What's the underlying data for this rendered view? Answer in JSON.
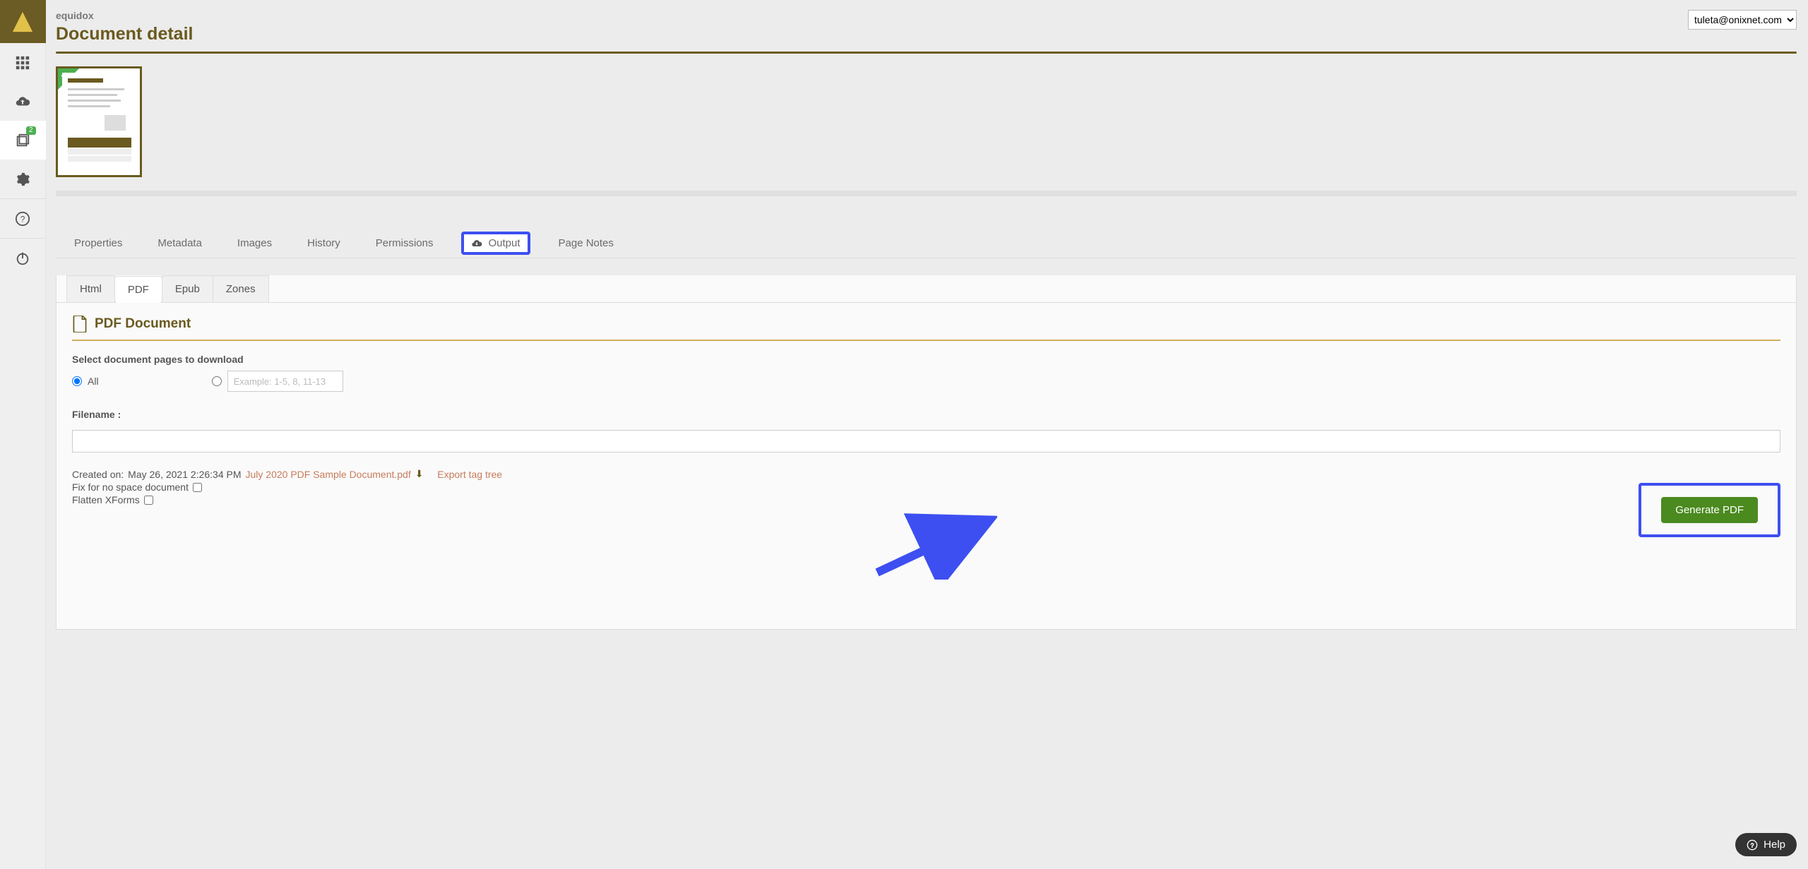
{
  "brand": "equidox",
  "page_title": "Document detail",
  "user_email": "tuleta@onixnet.com",
  "rail": {
    "badge": "2"
  },
  "tabs": {
    "properties": "Properties",
    "metadata": "Metadata",
    "images": "Images",
    "history": "History",
    "permissions": "Permissions",
    "output": "Output",
    "page_notes": "Page Notes"
  },
  "subtabs": {
    "html": "Html",
    "pdf": "PDF",
    "epub": "Epub",
    "zones": "Zones"
  },
  "pdf_section": {
    "title": "PDF Document",
    "select_label": "Select document pages to download",
    "radio_all": "All",
    "pages_placeholder": "Example: 1-5, 8, 11-13",
    "filename_label": "Filename :",
    "created_prefix": "Created on:",
    "created_time": "May 26, 2021 2:26:34 PM",
    "source_file": "July 2020 PDF Sample Document.pdf",
    "export_tag_tree": "Export tag tree",
    "fix_label": "Fix for no space document",
    "flatten_label": "Flatten XForms",
    "generate_button": "Generate PDF"
  },
  "help_label": "Help"
}
